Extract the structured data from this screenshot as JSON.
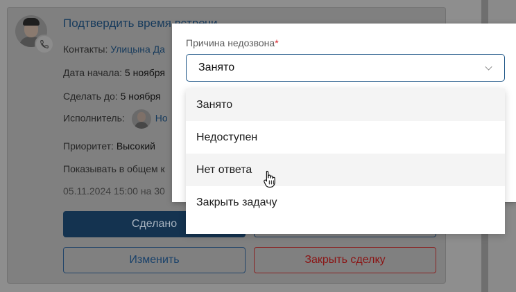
{
  "task": {
    "title": "Подтвердить время встречи",
    "contacts_label": "Контакты:",
    "contacts_value": "Улицына Да",
    "start_label": "Дата начала:",
    "start_value": "5 ноября",
    "due_label": "Сделать до:",
    "due_value": "5 ноября",
    "assignee_label": "Исполнитель:",
    "assignee_value": "Но",
    "priority_label": "Приоритет:",
    "priority_value": "Высокий",
    "show_label": "Показывать в общем к",
    "timestamp": "05.11.2024 15:00 на 30"
  },
  "actions": {
    "done_label": "Сделано",
    "edit_label": "Изменить",
    "close_deal_label": "Закрыть сделку"
  },
  "popup": {
    "field_label": "Причина недозвона",
    "required_mark": "*",
    "selected_value": "Занято",
    "options": [
      {
        "label": "Занято"
      },
      {
        "label": "Недоступен"
      },
      {
        "label": "Нет ответа"
      },
      {
        "label": "Закрыть задачу"
      }
    ]
  },
  "colors": {
    "accent": "#1f5687",
    "danger": "#d9262e",
    "option_hover": "#f4f4f4"
  },
  "icons": {
    "phone": "phone-icon",
    "chevron": "chevron-down-icon",
    "cursor": "hand-pointer-icon"
  }
}
